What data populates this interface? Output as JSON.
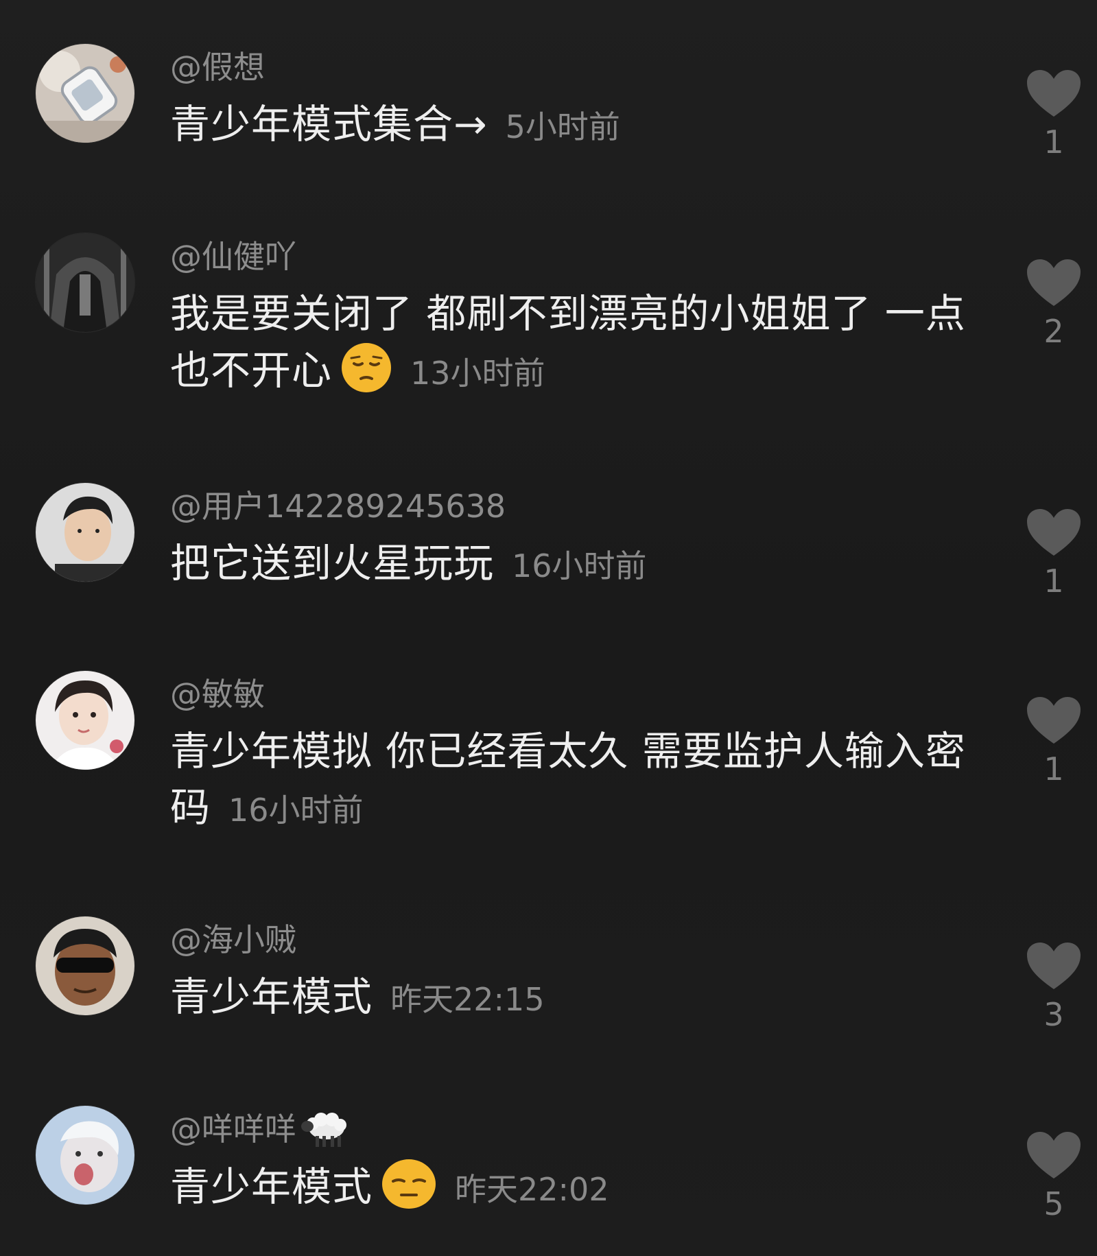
{
  "comments": [
    {
      "username": "@假想",
      "text": "青少年模式集合→",
      "time": "5小时前",
      "likes": "1",
      "avatar_icon": "avatar-photo-device"
    },
    {
      "username": "@仙健吖",
      "text": "我是要关闭了 都刷不到漂亮的小姐姐了 一点也不开心",
      "emoji": "pensive-face-emoji",
      "time": "13小时前",
      "likes": "2",
      "avatar_icon": "avatar-photo-dark-person"
    },
    {
      "username": "@用户142289245638",
      "text": "把它送到火星玩玩",
      "time": "16小时前",
      "likes": "1",
      "avatar_icon": "avatar-photo-man"
    },
    {
      "username": "@敏敏",
      "text": "青少年模拟 你已经看太久 需要监护人输入密码",
      "time": "16小时前",
      "likes": "1",
      "avatar_icon": "avatar-photo-girl"
    },
    {
      "username": "@海小贼",
      "text": "青少年模式",
      "time": "昨天22:15",
      "likes": "3",
      "avatar_icon": "avatar-photo-sunglasses"
    },
    {
      "username": "@咩咩咩",
      "username_icon": "sheep-icon",
      "text": "青少年模式",
      "emoji": "relieved-face-emoji",
      "time": "昨天22:02",
      "likes": "5",
      "avatar_icon": "avatar-photo-child"
    }
  ],
  "colors": {
    "background": "#1c1c1c",
    "text": "#eeeeee",
    "muted": "#8d8d8d",
    "heart": "#5a5a5a"
  }
}
